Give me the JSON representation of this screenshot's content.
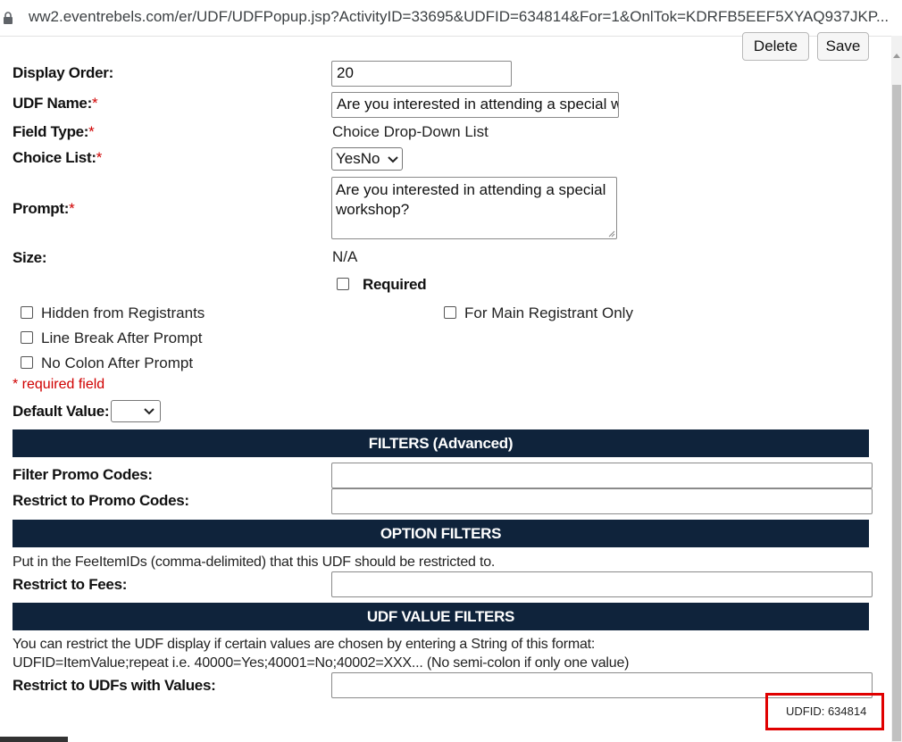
{
  "browser": {
    "url": "ww2.eventrebels.com/er/UDF/UDFPopup.jsp?ActivityID=33695&UDFID=634814&For=1&OnlTok=KDRFB5EEF5XYAQ937JKP..."
  },
  "toolbar": {
    "delete_label": "Delete",
    "save_label": "Save"
  },
  "form": {
    "display_order": {
      "label": "Display Order:",
      "value": "20"
    },
    "udf_name": {
      "label": "UDF Name:",
      "required_mark": "*",
      "value": "Are you interested in attending a special workshop?"
    },
    "field_type": {
      "label": "Field Type:",
      "required_mark": "*",
      "value": "Choice Drop-Down List"
    },
    "choice_list": {
      "label": "Choice List:",
      "required_mark": "*",
      "selected": "YesNo"
    },
    "prompt": {
      "label": "Prompt:",
      "required_mark": "*",
      "value": "Are you interested in attending a special workshop?"
    },
    "size": {
      "label": "Size:",
      "value": "N/A"
    },
    "required_checkbox": {
      "label": "Required",
      "checked": false
    },
    "options": {
      "hidden": {
        "label": "Hidden from Registrants",
        "checked": false
      },
      "main_only": {
        "label": "For Main Registrant Only",
        "checked": false
      },
      "line_break": {
        "label": "Line Break After Prompt",
        "checked": false
      },
      "no_colon": {
        "label": "No Colon After Prompt",
        "checked": false
      }
    },
    "required_note": "* required field",
    "default_value": {
      "label": "Default Value:",
      "selected": ""
    }
  },
  "filters": {
    "title": "FILTERS (Advanced)",
    "filter_promo": {
      "label": "Filter Promo Codes:",
      "value": ""
    },
    "restrict_promo": {
      "label": "Restrict to Promo Codes:",
      "value": ""
    }
  },
  "option_filters": {
    "title": "OPTION FILTERS",
    "note": "Put in the FeeItemIDs (comma-delimited) that this UDF should be restricted to.",
    "restrict_fees": {
      "label": "Restrict to Fees:",
      "value": ""
    }
  },
  "udf_value_filters": {
    "title": "UDF VALUE FILTERS",
    "note_line1": "You can restrict the UDF display if certain values are chosen by entering a String of this format:",
    "note_line2": "UDFID=ItemValue;repeat i.e. 40000=Yes;40001=No;40002=XXX... (No semi-colon if only one value)",
    "restrict_udfs": {
      "label": "Restrict to UDFs with Values:",
      "value": ""
    }
  },
  "footer": {
    "udfid_text": "UDFID: 634814"
  },
  "colors": {
    "band": "#0f233b",
    "required": "#d00000",
    "highlight": "#e00000"
  }
}
